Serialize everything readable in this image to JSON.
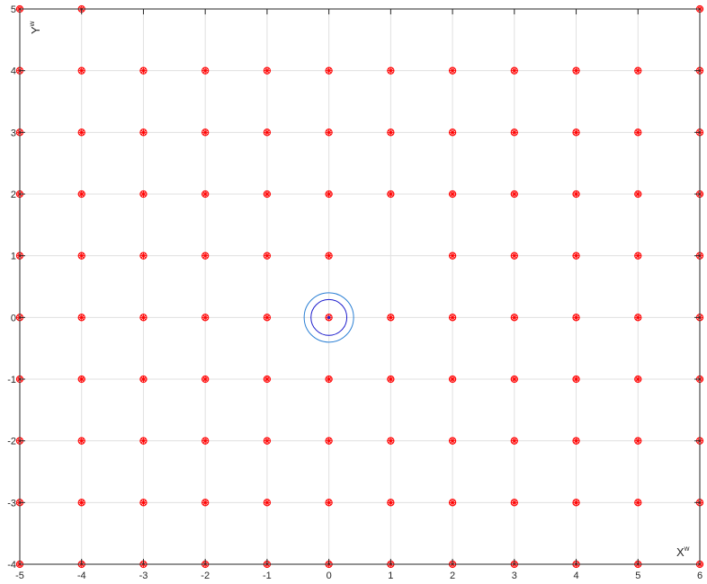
{
  "chart_data": {
    "type": "scatter",
    "title": "",
    "xlabel": "X",
    "xlabel_superscript": "w",
    "ylabel": "Y",
    "ylabel_superscript": "w",
    "xlim": [
      -5,
      6
    ],
    "ylim": [
      -4,
      5
    ],
    "xticks": [
      -5,
      -4,
      -3,
      -2,
      -1,
      0,
      1,
      2,
      3,
      4,
      5,
      6
    ],
    "yticks": [
      -4,
      -3,
      -2,
      -1,
      0,
      1,
      2,
      3,
      4,
      5
    ],
    "grid": true,
    "marker": "asterisk-circle",
    "points": [
      [
        -5,
        5
      ],
      [
        -4,
        5
      ],
      [
        6,
        5
      ],
      [
        -5,
        4
      ],
      [
        -4,
        4
      ],
      [
        -3,
        4
      ],
      [
        -2,
        4
      ],
      [
        -1,
        4
      ],
      [
        0,
        4
      ],
      [
        1,
        4
      ],
      [
        2,
        4
      ],
      [
        3,
        4
      ],
      [
        4,
        4
      ],
      [
        5,
        4
      ],
      [
        6,
        4
      ],
      [
        -5,
        3
      ],
      [
        -4,
        3
      ],
      [
        -3,
        3
      ],
      [
        -2,
        3
      ],
      [
        -1,
        3
      ],
      [
        0,
        3
      ],
      [
        1,
        3
      ],
      [
        2,
        3
      ],
      [
        3,
        3
      ],
      [
        4,
        3
      ],
      [
        5,
        3
      ],
      [
        6,
        3
      ],
      [
        -5,
        2
      ],
      [
        -4,
        2
      ],
      [
        -3,
        2
      ],
      [
        -2,
        2
      ],
      [
        -1,
        2
      ],
      [
        0,
        2
      ],
      [
        1,
        2
      ],
      [
        2,
        2
      ],
      [
        3,
        2
      ],
      [
        4,
        2
      ],
      [
        5,
        2
      ],
      [
        6,
        2
      ],
      [
        -5,
        1
      ],
      [
        -4,
        1
      ],
      [
        -3,
        1
      ],
      [
        -2,
        1
      ],
      [
        -1,
        1
      ],
      [
        0,
        1
      ],
      [
        2,
        1
      ],
      [
        3,
        1
      ],
      [
        4,
        1
      ],
      [
        5,
        1
      ],
      [
        6,
        1
      ],
      [
        -5,
        0
      ],
      [
        -4,
        0
      ],
      [
        -3,
        0
      ],
      [
        -2,
        0
      ],
      [
        -1,
        0
      ],
      [
        0,
        0
      ],
      [
        1,
        0
      ],
      [
        2,
        0
      ],
      [
        3,
        0
      ],
      [
        4,
        0
      ],
      [
        5,
        0
      ],
      [
        6,
        0
      ],
      [
        -5,
        -1
      ],
      [
        -4,
        -1
      ],
      [
        -3,
        -1
      ],
      [
        -2,
        -1
      ],
      [
        -1,
        -1
      ],
      [
        0,
        -1
      ],
      [
        1,
        -1
      ],
      [
        2,
        -1
      ],
      [
        3,
        -1
      ],
      [
        4,
        -1
      ],
      [
        5,
        -1
      ],
      [
        6,
        -1
      ],
      [
        -5,
        -2
      ],
      [
        -4,
        -2
      ],
      [
        -3,
        -2
      ],
      [
        -2,
        -2
      ],
      [
        -1,
        -2
      ],
      [
        0,
        -2
      ],
      [
        1,
        -2
      ],
      [
        2,
        -2
      ],
      [
        3,
        -2
      ],
      [
        4,
        -2
      ],
      [
        5,
        -2
      ],
      [
        6,
        -2
      ],
      [
        -5,
        -3
      ],
      [
        -4,
        -3
      ],
      [
        -3,
        -3
      ],
      [
        -2,
        -3
      ],
      [
        -1,
        -3
      ],
      [
        0,
        -3
      ],
      [
        1,
        -3
      ],
      [
        2,
        -3
      ],
      [
        3,
        -3
      ],
      [
        4,
        -3
      ],
      [
        5,
        -3
      ],
      [
        6,
        -3
      ],
      [
        -5,
        -4
      ],
      [
        -4,
        -4
      ],
      [
        -3,
        -4
      ],
      [
        -2,
        -4
      ],
      [
        -1,
        -4
      ],
      [
        0,
        -4
      ],
      [
        1,
        -4
      ],
      [
        2,
        -4
      ],
      [
        3,
        -4
      ],
      [
        4,
        -4
      ],
      [
        5,
        -4
      ],
      [
        6,
        -4
      ]
    ],
    "circles": [
      {
        "center": [
          0,
          0
        ],
        "radius": 0.4,
        "color": "#2a7fd4"
      },
      {
        "center": [
          0,
          0
        ],
        "radius": 0.29,
        "color": "#1a1acc"
      }
    ],
    "colors": {
      "marker": "#ff0000",
      "center_marker": "#2020d0",
      "grid": "#e0e0e0",
      "axis": "#262626"
    }
  }
}
